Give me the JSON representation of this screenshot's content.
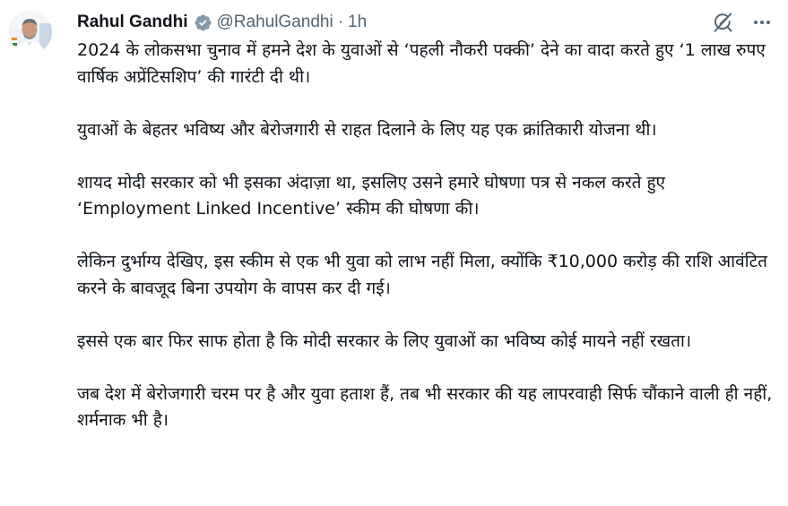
{
  "tweet": {
    "author": {
      "display_name": "Rahul Gandhi",
      "handle": "@RahulGandhi",
      "verified_icon": "verified-badge-icon",
      "avatar_icon": "avatar"
    },
    "separator": "·",
    "time": "1h",
    "actions": {
      "grok_icon": "grok-icon",
      "more_icon": "more-options-icon"
    },
    "paragraphs": [
      "2024 के लोकसभा चुनाव में हमने देश के युवाओं से ‘पहली नौकरी पक्की’ देने का वादा करते हुए ‘1 लाख रुपए वार्षिक अप्रेंटिसशिप’ की गारंटी दी थी।",
      "युवाओं के बेहतर भविष्य और बेरोजगारी से राहत दिलाने के लिए यह एक क्रांतिकारी योजना थी।",
      "शायद मोदी सरकार को भी इसका अंदाज़ा था, इसलिए उसने हमारे घोषणा पत्र से नकल करते हुए ‘Employment Linked Incentive’ स्कीम की घोषणा की।",
      "लेकिन दुर्भाग्य देखिए, इस स्कीम से एक भी युवा को लाभ नहीं मिला, क्योंकि ₹10,000 करोड़ की राशि आवंटित करने के बावजूद बिना उपयोग के वापस कर दी गई।",
      "इससे एक बार फिर साफ होता है कि मोदी सरकार के लिए युवाओं का भविष्य कोई मायने नहीं रखता।",
      "जब देश में बेरोजगारी चरम पर है और युवा हताश हैं, तब भी सरकार की यह लापरवाही सिर्फ चौंकाने वाली ही नहीं, शर्मनाक भी है।"
    ]
  },
  "colors": {
    "text_primary": "#0f1419",
    "text_secondary": "#536471",
    "verified_blue": "#1d9bf0",
    "background": "#ffffff"
  }
}
